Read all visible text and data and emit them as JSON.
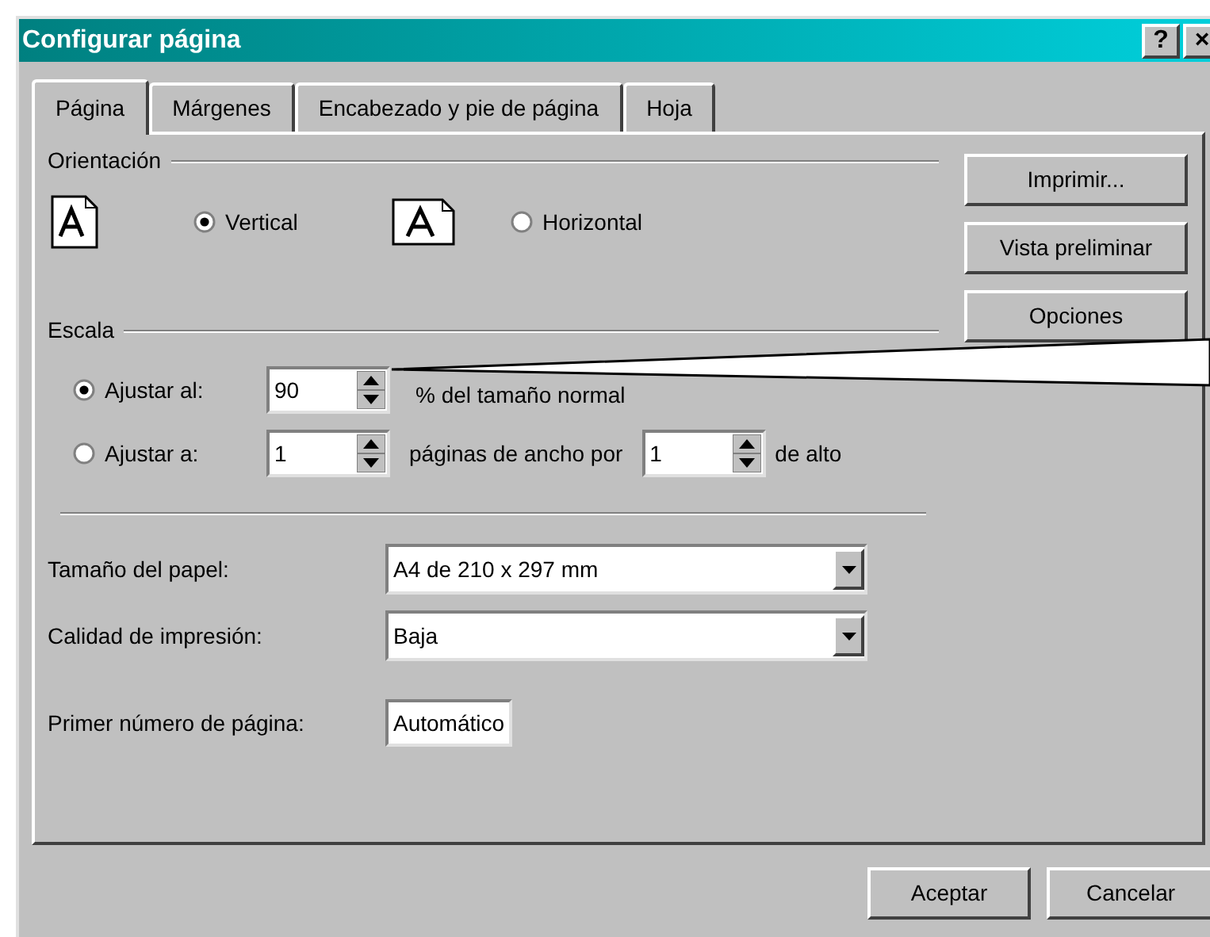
{
  "window": {
    "title": "Configurar página",
    "title_buttons": [
      "?",
      "×"
    ]
  },
  "tabs": [
    {
      "label": "Página",
      "selected": true
    },
    {
      "label": "Márgenes",
      "selected": false
    },
    {
      "label": "Encabezado y pie de página",
      "selected": false
    },
    {
      "label": "Hoja",
      "selected": false
    }
  ],
  "orientation": {
    "label": "Orientación",
    "options": [
      {
        "label": "Vertical",
        "kind": "portrait",
        "selected": true
      },
      {
        "label": "Horizontal",
        "kind": "landscape",
        "selected": false
      }
    ]
  },
  "scale": {
    "label": "Escala",
    "fit_percent": {
      "label": "Ajustar al:",
      "selected": true,
      "value": "90",
      "suffix": "% del tamaño normal"
    },
    "fit_pages": {
      "label": "Ajustar a:",
      "selected": false,
      "wide": "1",
      "middle": "páginas de ancho por",
      "tall": "1",
      "suffix": "de alto"
    }
  },
  "paper_size": {
    "label": "Tamaño del papel:",
    "value": "A4 de 210 x 297 mm"
  },
  "print_quality": {
    "label": "Calidad de impresión:",
    "value": "Baja"
  },
  "first_page_number": {
    "label": "Primer número de página:",
    "value": "Automático"
  },
  "side_buttons": [
    "Imprimir...",
    "Vista preliminar",
    "Opciones"
  ],
  "buttons": [
    "Aceptar",
    "Cancelar"
  ]
}
